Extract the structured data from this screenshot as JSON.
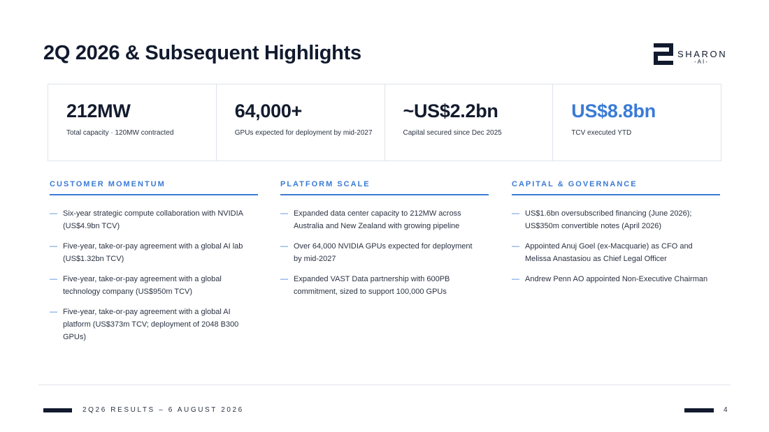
{
  "header": {
    "title": "2Q 2026 & Subsequent Highlights",
    "logo": {
      "word": "SHARON",
      "sub": "-AI-"
    }
  },
  "kpis": [
    {
      "value": "212MW",
      "caption": "Total capacity · 120MW contracted"
    },
    {
      "value": "64,000+",
      "caption": "GPUs expected for deployment by mid-2027"
    },
    {
      "value": "~US$2.2bn",
      "caption": "Capital secured since Dec 2025"
    },
    {
      "value": "US$8.8bn",
      "caption": "TCV executed YTD"
    }
  ],
  "columns": [
    {
      "heading": "CUSTOMER MOMENTUM",
      "bullets": [
        "Six-year strategic compute collaboration with NVIDIA (US$4.9bn TCV)",
        "Five-year, take-or-pay agreement with a global AI lab (US$1.32bn TCV)",
        "Five-year, take-or-pay agreement with a global technology company (US$950m TCV)",
        "Five-year, take-or-pay agreement with a global AI platform (US$373m TCV; deployment of 2048 B300 GPUs)"
      ]
    },
    {
      "heading": "PLATFORM SCALE",
      "bullets": [
        "Expanded data center capacity to 212MW across Australia and New Zealand with growing pipeline",
        "Over 64,000 NVIDIA GPUs expected for deployment by mid-2027",
        "Expanded VAST Data partnership with 600PB commitment, sized to support 100,000 GPUs"
      ]
    },
    {
      "heading": "CAPITAL & GOVERNANCE",
      "bullets": [
        "US$1.6bn oversubscribed financing (June 2026); US$350m convertible notes (April 2026)",
        "Appointed Anuj Goel (ex-Macquarie) as CFO and Melissa Anastasiou as Chief Legal Officer",
        "Andrew Penn AO appointed Non-Executive Chairman"
      ]
    }
  ],
  "bullet_marker": "—",
  "footer": {
    "text": "2Q26 RESULTS – 6 AUGUST 2026",
    "page": "4"
  },
  "colors": {
    "accent": "#3a7bd5",
    "navy": "#111a2e",
    "border": "#dfe3ea"
  }
}
